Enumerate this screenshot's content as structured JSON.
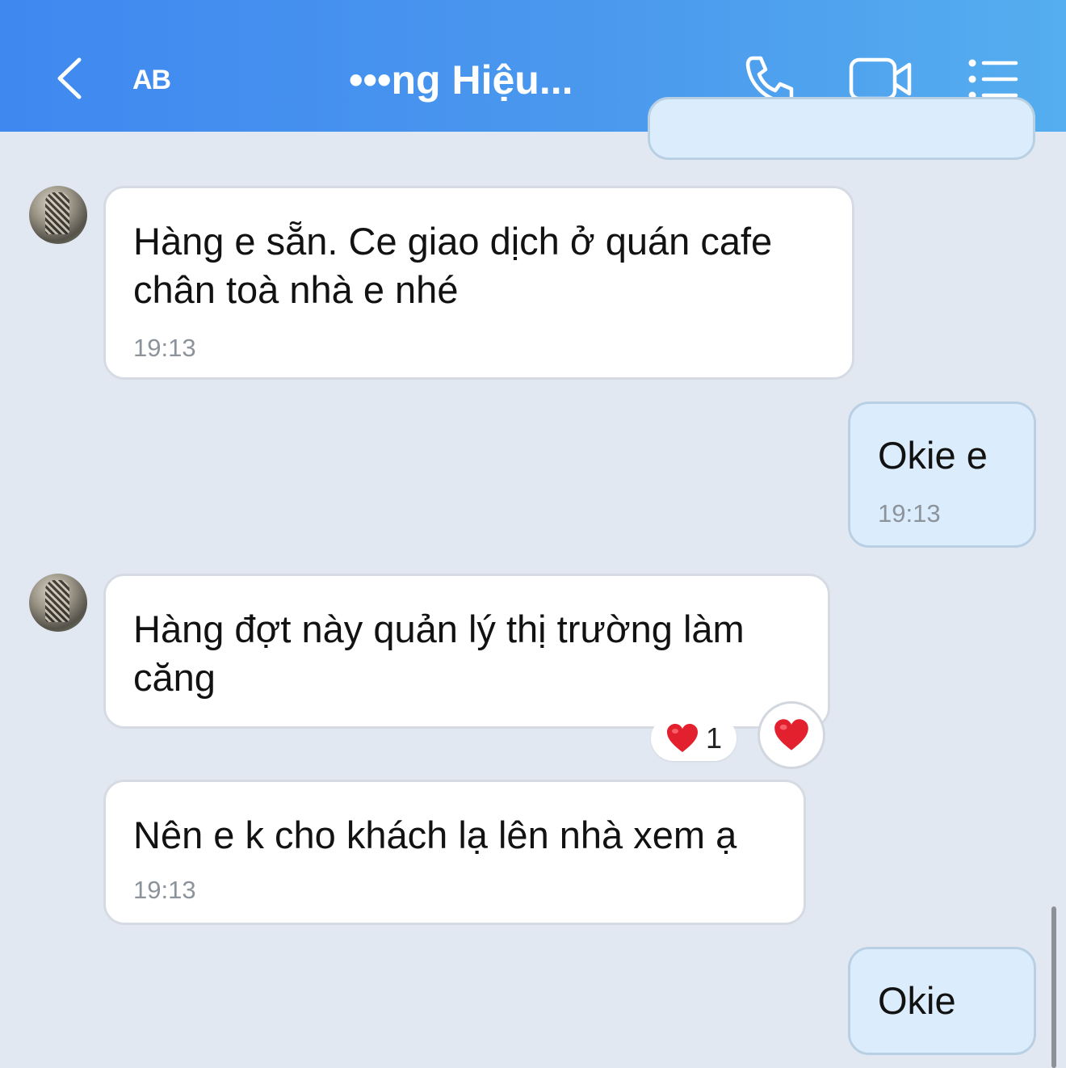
{
  "header": {
    "short_label": "AB",
    "title": "•••ng Hiệu..."
  },
  "messages": [
    {
      "text": "Hàng e sẵn. Ce giao dịch ở quán cafe chân toà nhà e nhé",
      "time": "19:13"
    },
    {
      "text": "Okie e",
      "time": "19:13"
    },
    {
      "text": "Hàng đợt này quản lý thị trường làm căng"
    },
    {
      "text": "Nên e k cho khách lạ lên nhà xem ạ",
      "time": "19:13"
    },
    {
      "text": "Okie"
    }
  ],
  "reaction": {
    "emoji": "heart",
    "count": "1"
  },
  "colors": {
    "header_start": "#3f88f0",
    "header_end": "#55aeef",
    "background": "#e2e8f1",
    "outgoing_bubble": "#dbedfd",
    "heart": "#e3202d"
  }
}
